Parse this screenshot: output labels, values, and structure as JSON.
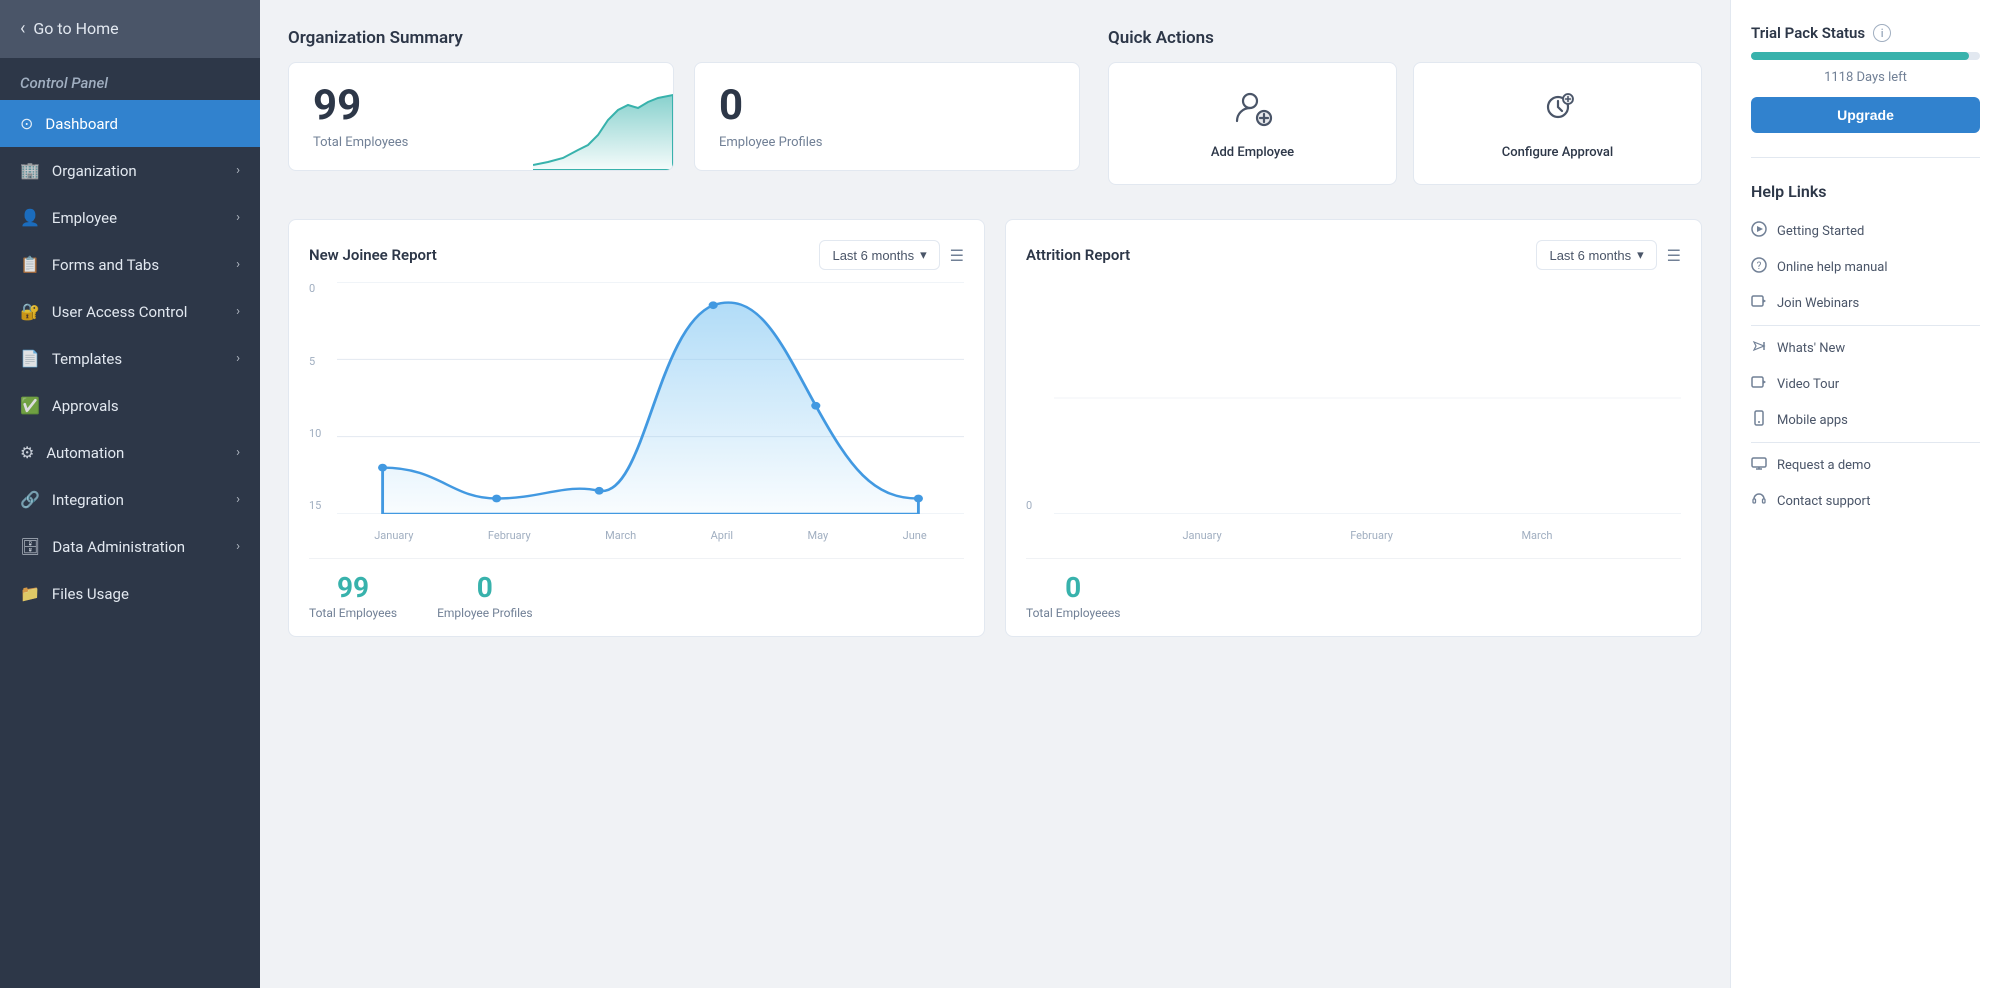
{
  "sidebar": {
    "home_label": "Go to Home",
    "control_panel_label": "Control Panel",
    "items": [
      {
        "id": "dashboard",
        "label": "Dashboard",
        "icon": "⊙",
        "active": true,
        "has_chevron": false
      },
      {
        "id": "organization",
        "label": "Organization",
        "icon": "🏢",
        "active": false,
        "has_chevron": true
      },
      {
        "id": "employee",
        "label": "Employee",
        "icon": "👤",
        "active": false,
        "has_chevron": true
      },
      {
        "id": "forms-and-tabs",
        "label": "Forms and Tabs",
        "icon": "📋",
        "active": false,
        "has_chevron": true
      },
      {
        "id": "user-access-control",
        "label": "User Access Control",
        "icon": "🔐",
        "active": false,
        "has_chevron": true
      },
      {
        "id": "templates",
        "label": "Templates",
        "icon": "📄",
        "active": false,
        "has_chevron": true
      },
      {
        "id": "approvals",
        "label": "Approvals",
        "icon": "✅",
        "active": false,
        "has_chevron": false
      },
      {
        "id": "automation",
        "label": "Automation",
        "icon": "⚙",
        "active": false,
        "has_chevron": true
      },
      {
        "id": "integration",
        "label": "Integration",
        "icon": "🔗",
        "active": false,
        "has_chevron": true
      },
      {
        "id": "data-administration",
        "label": "Data Administration",
        "icon": "🗄",
        "active": false,
        "has_chevron": true
      },
      {
        "id": "files-usage",
        "label": "Files Usage",
        "icon": "📁",
        "active": false,
        "has_chevron": false
      }
    ]
  },
  "header": {
    "org_summary_title": "Organization Summary",
    "quick_actions_title": "Quick Actions"
  },
  "org_summary": {
    "total_employees": "99",
    "total_employees_label": "Total Employees",
    "employee_profiles": "0",
    "employee_profiles_label": "Employee Profiles"
  },
  "quick_actions": {
    "actions": [
      {
        "id": "add-employee",
        "label": "Add Employee",
        "icon": "add-employee-icon"
      },
      {
        "id": "configure-approval",
        "label": "Configure Approval",
        "icon": "configure-approval-icon"
      }
    ]
  },
  "new_joinee_report": {
    "title": "New Joinee Report",
    "filter_label": "Last 6 months",
    "x_labels": [
      "January",
      "February",
      "March",
      "April",
      "May",
      "June"
    ],
    "y_labels": [
      "0",
      "5",
      "10",
      "15"
    ],
    "total_employees_number": "99",
    "total_employees_label": "Total Employees",
    "employee_profiles_number": "0",
    "employee_profiles_label": "Employee Profiles"
  },
  "attrition_report": {
    "title": "Attrition Report",
    "filter_label": "Last 6 months",
    "x_labels": [
      "January",
      "February",
      "March"
    ],
    "y_labels": [
      "0"
    ],
    "total_employees_number": "0",
    "total_employees_label": "Total Employeees"
  },
  "trial_pack": {
    "title": "Trial Pack Status",
    "days_left": "1118 Days left",
    "progress_percent": 95,
    "upgrade_label": "Upgrade"
  },
  "help_links": {
    "title": "Help Links",
    "links": [
      {
        "id": "getting-started",
        "label": "Getting Started",
        "icon": "▶"
      },
      {
        "id": "online-help-manual",
        "label": "Online help manual",
        "icon": "?"
      },
      {
        "id": "join-webinars",
        "label": "Join Webinars",
        "icon": "📹"
      },
      {
        "id": "whats-new",
        "label": "Whats' New",
        "icon": "📢"
      },
      {
        "id": "video-tour",
        "label": "Video Tour",
        "icon": "▶"
      },
      {
        "id": "mobile-apps",
        "label": "Mobile apps",
        "icon": "📱"
      },
      {
        "id": "request-demo",
        "label": "Request a demo",
        "icon": "🖥"
      },
      {
        "id": "contact-support",
        "label": "Contact support",
        "icon": "🎧"
      }
    ]
  }
}
